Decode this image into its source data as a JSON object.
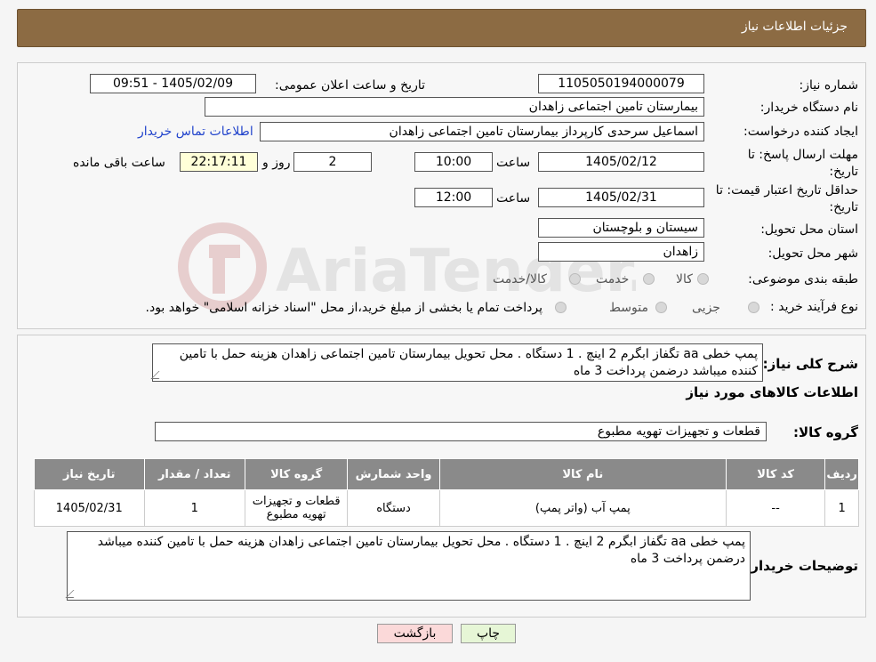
{
  "header": {
    "title": "جزئیات اطلاعات نیاز"
  },
  "fields": {
    "need_number_label": "شماره نیاز:",
    "need_number": "1105050194000079",
    "announce_label": "تاریخ و ساعت اعلان عمومی:",
    "announce_value": "1405/02/09 - 09:51",
    "buyer_org_label": "نام دستگاه خریدار:",
    "buyer_org": "بیمارستان تامین اجتماعی زاهدان",
    "creator_label": "ایجاد کننده درخواست:",
    "creator": "اسماعیل سرحدی کارپرداز بیمارستان تامین اجتماعی زاهدان",
    "contact_link": "اطلاعات تماس خریدار",
    "reply_deadline_label": "مهلت ارسال پاسخ: تا تاریخ:",
    "reply_date": "1405/02/12",
    "time_label": "ساعت",
    "reply_time": "10:00",
    "days": "2",
    "days_label": "روز و",
    "remaining": "22:17:11",
    "remaining_label": "ساعت باقی مانده",
    "min_validity_label": "حداقل تاریخ اعتبار قیمت: تا تاریخ:",
    "validity_date": "1405/02/31",
    "validity_time": "12:00",
    "province_label": "استان محل تحویل:",
    "province": "سیستان و بلوچستان",
    "city_label": "شهر محل تحویل:",
    "city": "زاهدان",
    "category_label": "طبقه بندی موضوعی:",
    "category_options": [
      "کالا",
      "خدمت",
      "کالا/خدمت"
    ],
    "process_label": "نوع فرآیند خرید :",
    "process_options": [
      "جزیی",
      "متوسط"
    ],
    "process_note": "پرداخت تمام یا بخشی از مبلغ خرید،از محل \"اسناد خزانه اسلامی\" خواهد بود."
  },
  "description": {
    "label": "شرح کلی نیاز:",
    "text": "پمپ خطی aa تگفاز ابگرم 2 اینچ . 1 دستگاه . محل تحویل بیمارستان تامین اجتماعی زاهدان هزینه حمل با تامین کننده میباشد    درضمن پرداخت 3 ماه"
  },
  "goods": {
    "section_title": "اطلاعات کالاهای مورد نیاز",
    "group_label": "گروه کالا:",
    "group_value": "قطعات و تجهیزات تهویه مطبوع",
    "columns": [
      "ردیف",
      "کد کالا",
      "نام کالا",
      "واحد شمارش",
      "گروه کالا",
      "تعداد / مقدار",
      "تاریخ نیاز"
    ],
    "rows": [
      [
        "1",
        "--",
        "پمپ آب (واتر پمپ)",
        "دستگاه",
        "قطعات و تجهیزات تهویه مطبوع",
        "1",
        "1405/02/31"
      ]
    ]
  },
  "buyer_notes": {
    "label": "توضیحات خریدار:",
    "text": "پمپ خطی aa تگفاز ابگرم 2 اینچ . 1 دستگاه . محل تحویل بیمارستان تامین اجتماعی زاهدان هزینه حمل با تامین کننده میباشد    درضمن پرداخت 3 ماه"
  },
  "buttons": {
    "print": "چاپ",
    "back": "بازگشت"
  },
  "watermark": {
    "text": "AriaTender.neT"
  },
  "colors": {
    "header_bg": "#8c6b43",
    "table_header": "#8a8a8a",
    "link": "#2244cc",
    "back_btn": "#fbd9d9",
    "print_btn": "#e6f6d6"
  }
}
